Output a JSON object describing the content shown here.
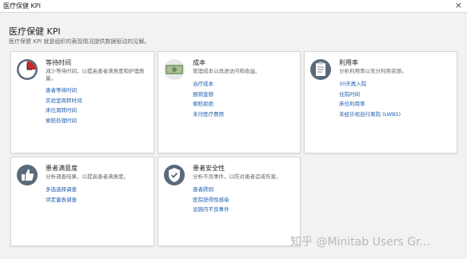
{
  "window": {
    "title": "医疗保健 KPI",
    "close_glyph": "×"
  },
  "header": {
    "title": "医疗保健 KPI",
    "subtitle": "医疗保健 KPI 就是组织的表现情况提供数据驱动的见解。"
  },
  "cards": [
    {
      "title": "等待时间",
      "description": "减少等待时间，以提高患者满意度和护理质量。",
      "icon": "clock-icon",
      "links": [
        "患者等待时间",
        "实验室周转时间",
        "床位周转时间",
        "索赔处理时间"
      ]
    },
    {
      "title": "成本",
      "description": "管理成本以改进访问和收益。",
      "icon": "money-icon",
      "links": [
        "治疗成本",
        "报销金额",
        "索赔拒绝",
        "未付医疗费用"
      ]
    },
    {
      "title": "利用率",
      "description": "分析利用率以充分利用资源。",
      "icon": "clipboard-icon",
      "links": [
        "30天再入院",
        "住院时间",
        "床位利用率",
        "未经诊视自行离院 (LWBS)"
      ]
    },
    {
      "title": "患者满意度",
      "description": "分析调查结果，以提高患者满意度。",
      "icon": "thumbs-up-icon",
      "links": [
        "多选选择调查",
        "评定量表调查"
      ]
    },
    {
      "title": "患者安全性",
      "description": "分析不良事件，以防对患者造成伤害。",
      "icon": "shield-check-icon",
      "links": [
        "患者跌倒",
        "医院获得性感染",
        "设施内不良事件"
      ]
    }
  ],
  "watermark": "知乎 @Minitab Users Gr...",
  "colors": {
    "link": "#1f5fb0",
    "clock_red": "#c8282d",
    "icon_bg": "#5a6a7a"
  }
}
